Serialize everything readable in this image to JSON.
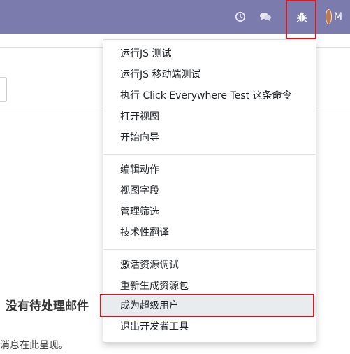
{
  "topbar": {
    "icons": [
      "clock-icon",
      "chat-icon",
      "bug-icon",
      "avatar"
    ],
    "avatar_letter": "M",
    "colors": {
      "bar": "#7c7bad",
      "highlight": "#c8202a"
    }
  },
  "main": {
    "empty_title": "没有待处理邮件",
    "empty_text": "消息在此呈现。"
  },
  "debug_menu": {
    "groups": [
      [
        "运行JS 测试",
        "运行JS 移动端测试",
        "执行 Click Everywhere Test 这条命令",
        "打开视图",
        "开始向导"
      ],
      [
        "编辑动作",
        "视图字段",
        "管理筛选",
        "技术性翻译"
      ],
      [
        "激活资源调试",
        "重新生成资源包",
        "成为超级用户",
        "退出开发者工具"
      ]
    ],
    "active_item": "成为超级用户"
  }
}
